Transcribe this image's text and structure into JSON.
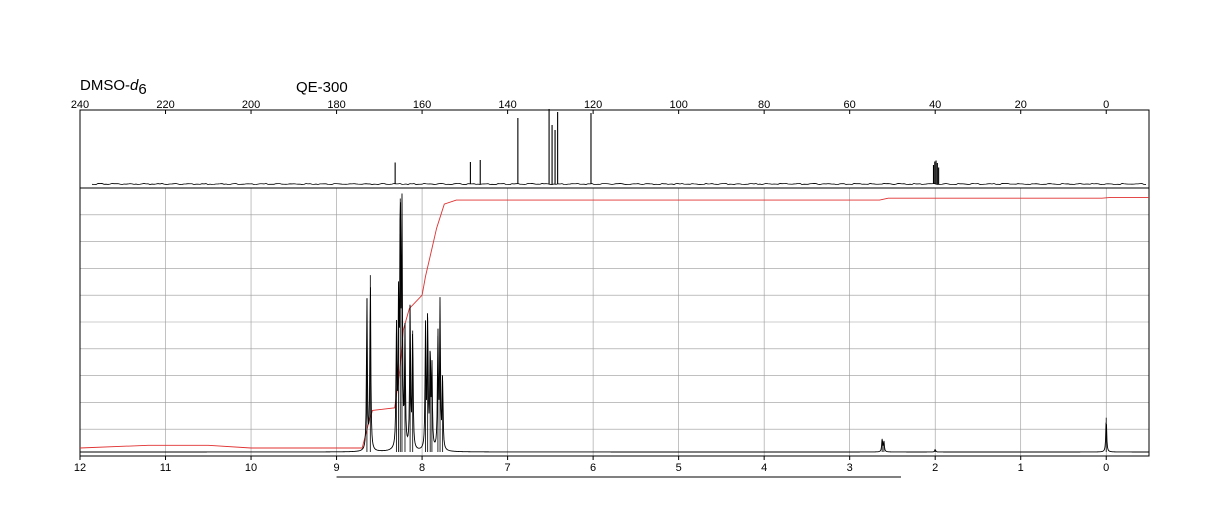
{
  "header": {
    "solvent_prefix": "DMSO-",
    "solvent_d": "d",
    "solvent_sub": "6",
    "instrument": "QE-300"
  },
  "colors": {
    "spectrum": "#000000",
    "integral": "#e03030",
    "grid": "#9a9a9a",
    "frame": "#000000"
  },
  "chart_data": [
    {
      "id": "13C",
      "type": "line",
      "title": "",
      "xlabel": "",
      "ylabel": "",
      "x_reversed": true,
      "xlim": [
        240,
        -10
      ],
      "xticks": [
        240,
        220,
        200,
        180,
        160,
        140,
        120,
        100,
        80,
        60,
        40,
        20,
        0
      ],
      "tick_label_position": "top",
      "grid": false,
      "peaks": [
        {
          "x": 166.3,
          "height": 0.43
        },
        {
          "x": 148.7,
          "height": 0.44
        },
        {
          "x": 146.4,
          "height": 0.48
        },
        {
          "x": 137.6,
          "height": 1.32
        },
        {
          "x": 130.3,
          "height": 1.5
        },
        {
          "x": 129.6,
          "height": 1.18
        },
        {
          "x": 128.9,
          "height": 1.08
        },
        {
          "x": 128.3,
          "height": 1.44
        },
        {
          "x": 120.5,
          "height": 1.42
        },
        {
          "x": 40.4,
          "height": 0.38
        },
        {
          "x": 40.1,
          "height": 0.45
        },
        {
          "x": 39.8,
          "height": 0.47
        },
        {
          "x": 39.5,
          "height": 0.42
        },
        {
          "x": 39.2,
          "height": 0.33
        }
      ]
    },
    {
      "id": "1H",
      "type": "line",
      "title": "",
      "xlabel": "",
      "ylabel": "",
      "x_reversed": true,
      "xlim": [
        12,
        -0.5
      ],
      "xticks": [
        12,
        11,
        10,
        9,
        8,
        7,
        6,
        5,
        4,
        3,
        2,
        1,
        0
      ],
      "tick_label_position": "bottom",
      "grid": true,
      "grid_rows": 10,
      "peaks": [
        {
          "x": 8.645,
          "height": 0.58
        },
        {
          "x": 8.605,
          "height": 0.67
        },
        {
          "x": 8.3,
          "height": 0.45
        },
        {
          "x": 8.275,
          "height": 0.53
        },
        {
          "x": 8.255,
          "height": 0.96
        },
        {
          "x": 8.235,
          "height": 0.87
        },
        {
          "x": 8.2,
          "height": 0.44
        },
        {
          "x": 8.14,
          "height": 0.55
        },
        {
          "x": 8.11,
          "height": 0.46
        },
        {
          "x": 7.96,
          "height": 0.46
        },
        {
          "x": 7.935,
          "height": 0.51
        },
        {
          "x": 7.905,
          "height": 0.38
        },
        {
          "x": 7.885,
          "height": 0.31
        },
        {
          "x": 7.815,
          "height": 0.44
        },
        {
          "x": 7.79,
          "height": 0.55
        },
        {
          "x": 7.76,
          "height": 0.27
        },
        {
          "x": 2.62,
          "height": 0.05
        },
        {
          "x": 2.6,
          "height": 0.04
        },
        {
          "x": 2.0,
          "height": 0.01
        },
        {
          "x": 0.0,
          "height": 0.13
        }
      ],
      "integral": {
        "x": [
          12.0,
          11.2,
          10.5,
          10.0,
          9.2,
          8.7,
          8.62,
          8.58,
          8.32,
          8.26,
          8.22,
          8.15,
          8.0,
          7.96,
          7.88,
          7.83,
          7.74,
          7.6,
          7.0,
          5.0,
          2.65,
          2.55,
          1.0,
          0.05,
          -0.05,
          -0.5
        ],
        "y": [
          0.03,
          0.04,
          0.04,
          0.03,
          0.03,
          0.03,
          0.13,
          0.17,
          0.18,
          0.32,
          0.47,
          0.55,
          0.6,
          0.67,
          0.78,
          0.85,
          0.94,
          0.955,
          0.955,
          0.955,
          0.955,
          0.962,
          0.962,
          0.962,
          0.965,
          0.965
        ]
      },
      "reference_line": {
        "from": 9.0,
        "to": 2.4
      }
    }
  ]
}
